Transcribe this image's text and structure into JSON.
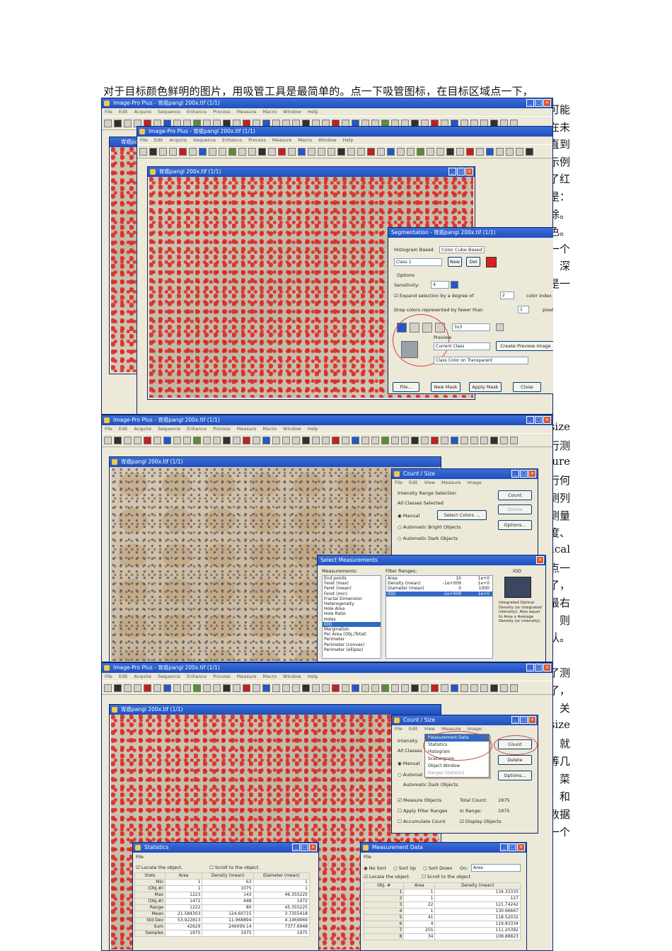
{
  "intro_text": "对于目标颜色鲜明的图片，用吸管工具是最简单的。点一下吸管图标，在目标区域点一下，",
  "side_fragments_1": [
    "可能",
    "在未",
    "直到",
    "示例",
    "了红",
    "是：",
    "除。",
    "色。",
    "一个",
    "深",
    "是一"
  ],
  "side_fragments_2": [
    "size",
    "行测",
    "sure",
    "行何",
    "测列",
    "测量",
    "度、",
    "ical",
    "点一",
    "了，",
    "最右",
    "则",
    "认。"
  ],
  "side_fragments_3": [
    "了测",
    "了，",
    "关",
    "size",
    "就",
    "等几",
    "菜",
    "和",
    "数据",
    "中每一个"
  ],
  "app": {
    "title": "Image-Pro Plus - 胃癌pangl  200x.tif (1/1)",
    "menu": [
      "File",
      "Edit",
      "Acquire",
      "Sequence",
      "Enhance",
      "Process",
      "Measure",
      "Macro",
      "Window",
      "Help"
    ]
  },
  "panel1": {
    "bg_window_title": "Image-Pro Plus - 胃癌pangl  200x.tif (1/1)",
    "back_image_title": "胃癌pan",
    "image_title": "胃癌pangl  200x.tif (1/1)",
    "segmentation": {
      "title": "Segmentation - 胃癌pangl  200x.tif (1/1)",
      "tab_histogram": "Histogram Based",
      "tab_cube": "Color Cube Based",
      "class_value": "Class 1",
      "new_label": "New",
      "del_label": "Del",
      "options_label": "Options",
      "sensitivity_label": "Sensitivity:",
      "sensitivity_value": "4",
      "expand_label": "Expand selection by a degree of",
      "expand_value": "2",
      "color_index_label": "color index",
      "drop_label": "Drop colors represented by fewer than",
      "drop_value": "1",
      "pixels_label": "pixels",
      "zoom_value": "3x3",
      "preview_label": "Preview",
      "preview_select": "Current Class",
      "create_preview_label": "Create Preview Image",
      "class_color_select": "Class Color on Transparent",
      "file_button": "File...",
      "new_mask_button": "New Mask",
      "apply_mask_button": "Apply Mask",
      "close_button": "Close"
    }
  },
  "panel2": {
    "image_title": "胃癌pangl  200x.tif (1/1)",
    "count_size": {
      "title": "Count / Size",
      "menu": [
        "File",
        "Edit",
        "View",
        "Measure",
        "Image"
      ],
      "intensity_label": "Intensity Range Selection",
      "all_classes": "All Classes Selected",
      "manual": "Manual",
      "select_colors": "Select Colors ...",
      "auto_bright": "Automatic Bright Objects",
      "auto_dark": "Automatic Dark Objects",
      "count_button": "Count",
      "delete_button": "Delete",
      "options_button": "Options..."
    },
    "select_measurements": {
      "title": "Select Measurements",
      "measurements_label": "Measurements:",
      "filter_label": "Filter Ranges:",
      "list": [
        "End points",
        "Feret (max)",
        "Feret (mean)",
        "Feret (min)",
        "Fractal Dimension",
        "Heterogeneity",
        "Hole Area",
        "Hole Ratio",
        "Holes",
        "IOD",
        "Margination",
        "Per Area (Obj./Total)",
        "Perimeter",
        "Perimeter (convex)",
        "Perimeter (ellipse)"
      ],
      "selected": "IOD",
      "filters": [
        {
          "name": "Area",
          "min": "10",
          "max": "1e+0"
        },
        {
          "name": "Density (mean)",
          "min": "-1e+009",
          "max": "1e+0"
        },
        {
          "name": "Diameter (mean)",
          "min": "0",
          "max": "1000"
        },
        {
          "name": "IOD",
          "min": "-1e+009",
          "max": "1e+0"
        }
      ],
      "iod_heading": "IOD",
      "iod_description": "Integrated Optical Density (or integrated intensity). Also equal to Area x Average Density (or intensity)."
    }
  },
  "panel3": {
    "image_title": "胃癌pangl  200x.tif (1/1)",
    "count_size": {
      "title": "Count / Size",
      "menu": [
        "File",
        "Edit",
        "View",
        "Measure",
        "Image"
      ],
      "dropdown": [
        "Measurement Data",
        "Statistics",
        "Histogram",
        "Scattergram",
        "Object Window",
        "Ranges Statistics"
      ],
      "intensity_label": "Intensity",
      "all_classes": "All Classes",
      "manual": "Manual",
      "automatic": "Automat",
      "automatic_dark": "Automatic Dark Objects",
      "count_button": "Count",
      "delete_button": "Delete",
      "options_button": "Options...",
      "measure_objects": "Measure Objects",
      "total_count_label": "Total Count:",
      "total_count": "1975",
      "apply_filter": "Apply Filter Ranges",
      "in_range_label": "In Range:",
      "in_range": "1975",
      "accumulate": "Accumulate Count",
      "display_objects": "Display Objects"
    },
    "statistics": {
      "title": "Statistics",
      "menu": "File",
      "locate": "Locate the object.",
      "scroll": "Scroll to the object.",
      "columns": [
        "Stats",
        "Area",
        "Density (mean)",
        "Diameter (mean)"
      ],
      "rows": [
        [
          "Min",
          "1",
          "63",
          "1"
        ],
        [
          "(Obj.#)",
          "1",
          "1075",
          "1"
        ],
        [
          "Max",
          "1223",
          "143",
          "46.355225"
        ],
        [
          "(Obj.#)",
          "1472",
          "448",
          "1472"
        ],
        [
          "Range",
          "1222",
          "80",
          "45.355225"
        ],
        [
          "Mean",
          "21.584303",
          "124.60715",
          "3.7355418"
        ],
        [
          "Std Dev",
          "53.922813",
          "11.968894",
          "4.1469969"
        ],
        [
          "Sum",
          "42629",
          "246099.14",
          "7377.6948"
        ],
        [
          "Samples",
          "1975",
          "1975",
          "1975"
        ]
      ]
    },
    "measurement_data": {
      "title": "Measurement Data",
      "menu": "File",
      "sort_no": "No Sort",
      "sort_up": "Sort Up",
      "sort_down": "Sort Down",
      "on_label": "On:",
      "on_value": "Area",
      "locate": "Locate the object",
      "scroll": "Scroll to the object",
      "columns": [
        "Obj. #",
        "Area",
        "Density (mean)"
      ],
      "rows": [
        [
          "1",
          "1",
          "134.33333"
        ],
        [
          "2",
          "1",
          "127"
        ],
        [
          "3",
          "22",
          "121.74242"
        ],
        [
          "4",
          "1",
          "130.66667"
        ],
        [
          "5",
          "41",
          "118.52032"
        ],
        [
          "6",
          "4",
          "119.83334"
        ],
        [
          "7",
          "255",
          "111.20392"
        ],
        [
          "8",
          "34",
          "108.88823"
        ]
      ]
    }
  }
}
